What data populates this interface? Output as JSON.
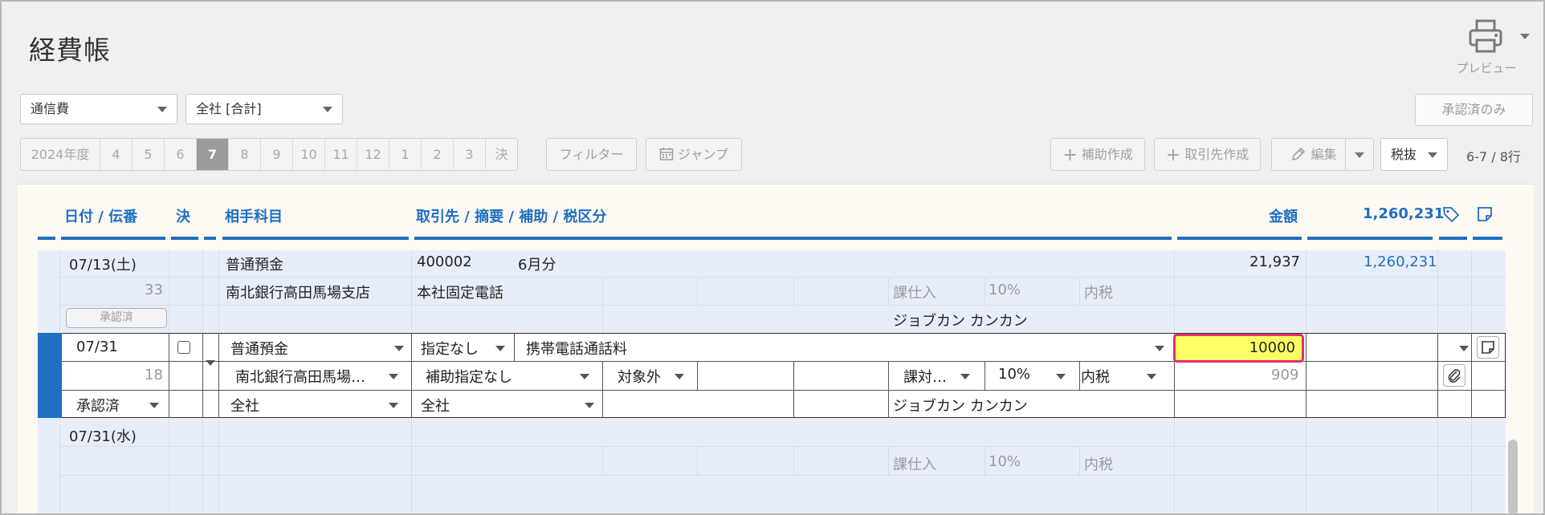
{
  "page": {
    "title": "経費帳"
  },
  "toolbar": {
    "preview_label": "プレビュー",
    "account_select": "通信費",
    "dept_select": "全社 [合計]",
    "approved_only": "承認済のみ",
    "year_label": "2024年度",
    "months": [
      "4",
      "5",
      "6",
      "7",
      "8",
      "9",
      "10",
      "11",
      "12",
      "1",
      "2",
      "3",
      "決"
    ],
    "active_month": "7",
    "filter": "フィルター",
    "jump": "ジャンプ",
    "add_sub": "補助作成",
    "add_partner": "取引先作成",
    "edit": "編集",
    "tax_mode": "税抜",
    "counter": "6-7 / 8行"
  },
  "columns": {
    "date": "日付 / 伝番",
    "settle": "決",
    "partner_account": "相手科目",
    "desc": "取引先 / 摘要 / 補助 / 税区分",
    "amount": "金額",
    "balance": "1,260,231"
  },
  "row1": {
    "date": "07/13(土)",
    "num": "33",
    "badge": "承認済",
    "account": "普通預金",
    "sub_account": "南北銀行高田馬場支店",
    "partner_code": "400002",
    "memo": "6月分",
    "memo2": "本社固定電話",
    "tax_kind": "課仕入",
    "tax_rate": "10%",
    "tax_incl": "内税",
    "user": "ジョブカン カンカン",
    "amount": "21,937",
    "balance": "1,260,231"
  },
  "edit_row": {
    "date": "07/31",
    "num": "18",
    "status": "承認済",
    "account": "普通預金",
    "sub_account": "南北銀行高田馬場…",
    "dept": "全社",
    "partner": "指定なし",
    "sub_assist": "補助指定なし",
    "dept2": "全社",
    "memo": "携帯電話通話料",
    "target": "対象外",
    "tax_kind": "課対…",
    "tax_rate": "10%",
    "tax_incl": "内税",
    "user": "ジョブカン カンカン",
    "amount": "10000",
    "tax_amount": "909"
  },
  "row3": {
    "date": "07/31(水)",
    "tax_kind": "課仕入",
    "tax_rate": "10%",
    "tax_incl": "内税"
  }
}
